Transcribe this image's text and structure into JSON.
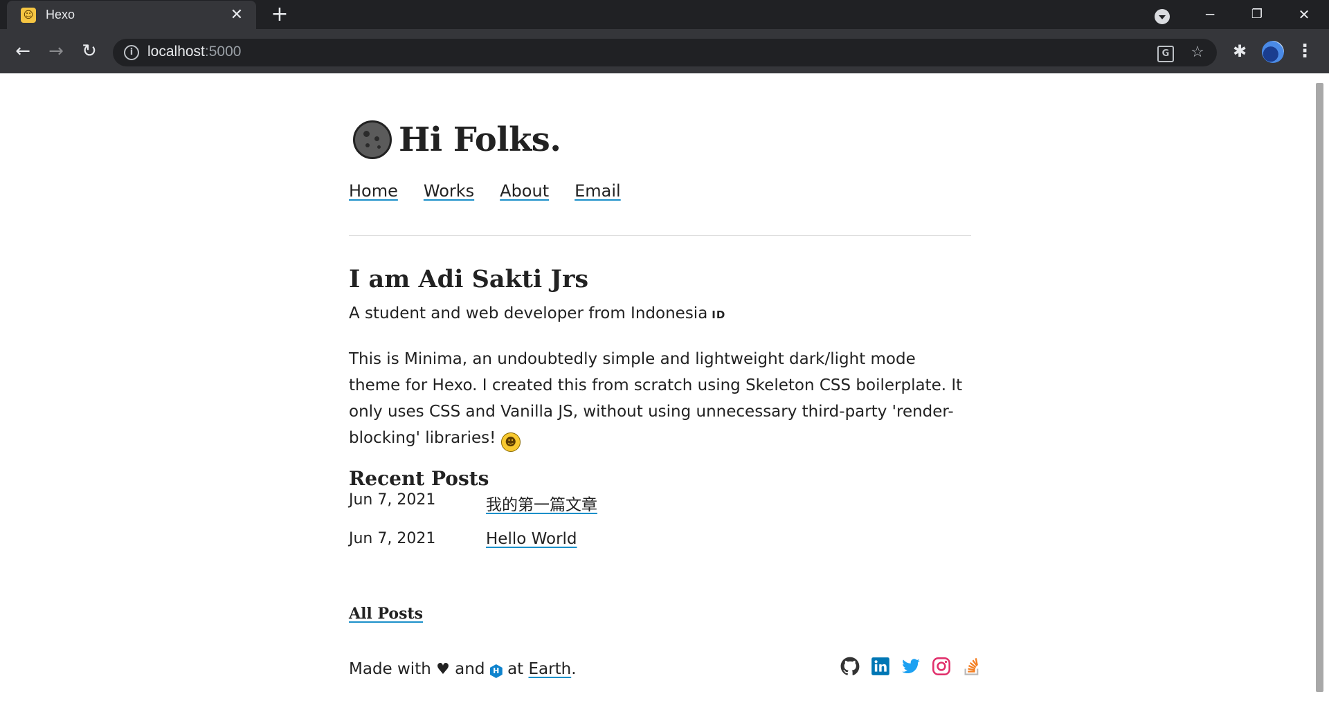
{
  "browser": {
    "tab_title": "Hexo",
    "url_host": "localhost",
    "url_port": ":5000"
  },
  "site": {
    "title": "Hi Folks.",
    "nav": [
      "Home",
      "Works",
      "About",
      "Email"
    ]
  },
  "intro": {
    "heading": "I am Adi Sakti Jrs",
    "tagline": "A student and web developer from Indonesia",
    "flag": "ID",
    "description": "This is Minima, an undoubtedly simple and lightweight dark/light mode theme for Hexo. I created this from scratch using Skeleton CSS boilerplate. It only uses CSS and Vanilla JS, without using unnecessary third-party 'render-blocking' libraries!"
  },
  "recent": {
    "heading": "Recent Posts",
    "posts": [
      {
        "date": "Jun 7, 2021",
        "title": "我的第一篇文章"
      },
      {
        "date": "Jun 7, 2021",
        "title": "Hello World"
      }
    ],
    "all_posts": "All Posts"
  },
  "footer": {
    "made_with": "Made with",
    "and": "and",
    "at": "at",
    "place": "Earth",
    "period": "."
  },
  "social": [
    {
      "icon": "github-icon",
      "color": "#333333"
    },
    {
      "icon": "linkedin-icon",
      "color": "#0077b5"
    },
    {
      "icon": "twitter-icon",
      "color": "#1da1f2"
    },
    {
      "icon": "instagram-icon",
      "color": "#e1306c"
    },
    {
      "icon": "stackoverflow-icon",
      "color": "#f48024"
    }
  ],
  "colors": {
    "link_underline": "#1a8fc9",
    "text": "#222222"
  }
}
